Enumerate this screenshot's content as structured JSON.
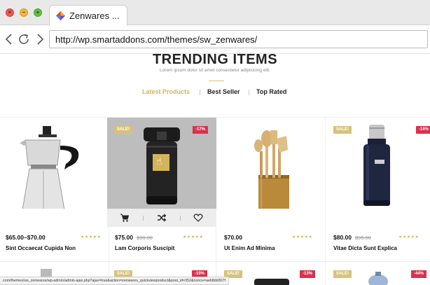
{
  "browser": {
    "tab_title": "Zenwares ...",
    "url": "http://wp.smartaddons.com/themes/sw_zenwares/",
    "status_url": "com/themes/sw_zenwares/wp-admin/admin-ajax.php?ajax=true&action=zenwares_quickviewproduct&post_id=352&nonce=aeb8dd307f"
  },
  "section": {
    "title": "TRENDING ITEMS",
    "subtitle": "Lorem ipsum dolor sit amet consectetur adipisicing elit.",
    "tabs": [
      {
        "label": "Latest Products",
        "active": true
      },
      {
        "label": "Best Seller",
        "active": false
      },
      {
        "label": "Top Rated",
        "active": false
      }
    ]
  },
  "products": [
    {
      "name": "Sint Occaecat Cupida Non",
      "price": "$65.00–$70.00",
      "old_price": "",
      "sale": "",
      "discount": "",
      "image": "moka-pot-icon"
    },
    {
      "name": "Lam Corporis Suscipit",
      "price": "$75.00",
      "old_price": "$90.00",
      "sale": "SALE!",
      "discount": "-17%",
      "image": "travel-mug-icon"
    },
    {
      "name": "Ut Enim Ad Minima",
      "price": "$70.00",
      "old_price": "",
      "sale": "",
      "discount": "",
      "image": "wooden-utensils-icon"
    },
    {
      "name": "Vitae Dicta Sunt Explica",
      "price": "$80.00",
      "old_price": "$95.00",
      "sale": "SALE!",
      "discount": "-16%",
      "image": "thermos-icon"
    }
  ],
  "row2_badges": [
    {
      "sale": "",
      "discount": ""
    },
    {
      "sale": "SALE!",
      "discount": "-10%"
    },
    {
      "sale": "SALE!",
      "discount": "-13%"
    },
    {
      "sale": "SALE!",
      "discount": "-44%"
    }
  ],
  "actions": {
    "cart": "cart-icon",
    "compare": "shuffle-icon",
    "wishlist": "heart-icon",
    "quickview": "pointer-hand-icon"
  },
  "colors": {
    "accent": "#d4b45a",
    "discount": "#d9324c",
    "sale": "#d8c27a"
  }
}
